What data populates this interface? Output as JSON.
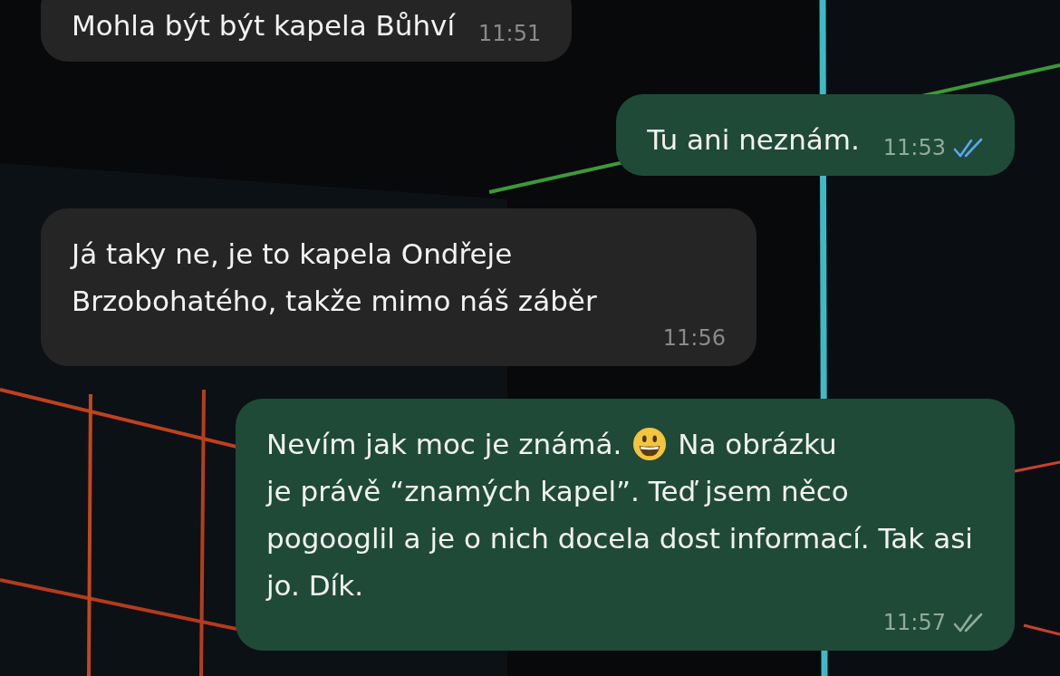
{
  "messages": [
    {
      "kind": "incoming",
      "parts": [
        {
          "kind": "text",
          "text": "Mohla být být kapela Bůhví"
        }
      ],
      "time": "11:51"
    },
    {
      "kind": "outgoing",
      "parts": [
        {
          "kind": "text",
          "text": "Tu ani neznám."
        }
      ],
      "time": "11:53",
      "read": true
    },
    {
      "kind": "incoming",
      "parts": [
        {
          "kind": "text",
          "text": "Já taky ne, je to kapela Ondřeje Brzobohatého, takže mimo náš záběr"
        }
      ],
      "time": "11:56"
    },
    {
      "kind": "outgoing",
      "parts": [
        {
          "kind": "text",
          "text": "Nevím jak moc je známá."
        },
        {
          "kind": "emoji"
        },
        {
          "kind": "text",
          "text": "Na obrázku"
        },
        {
          "kind": "text",
          "text": "je právě “znamých kapel”. Teď jsem něco pogooglil a je o nich docela dost informací. Tak asi jo. Dík."
        }
      ],
      "time": "11:57",
      "read": false
    }
  ]
}
